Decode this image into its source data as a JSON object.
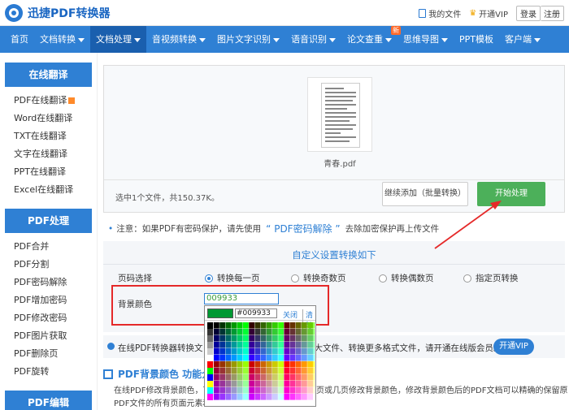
{
  "header": {
    "app_name": "迅捷PDF转换器",
    "my_files": "我的文件",
    "vip": "开通VIP",
    "login": "登录",
    "register": "注册"
  },
  "nav": {
    "items": [
      {
        "label": "首页",
        "dropdown": false
      },
      {
        "label": "文档转换",
        "dropdown": true
      },
      {
        "label": "文档处理",
        "dropdown": true,
        "active": true
      },
      {
        "label": "音视频转换",
        "dropdown": true
      },
      {
        "label": "图片文字识别",
        "dropdown": true
      },
      {
        "label": "语音识别",
        "dropdown": true
      },
      {
        "label": "论文查重",
        "dropdown": true,
        "badge": "新"
      },
      {
        "label": "思维导图",
        "dropdown": true
      },
      {
        "label": "PPT模板",
        "dropdown": false
      },
      {
        "label": "客户端",
        "dropdown": true
      }
    ]
  },
  "sidebar": {
    "sections": [
      {
        "title": "在线翻译",
        "items": [
          "PDF在线翻译",
          "Word在线翻译",
          "TXT在线翻译",
          "文字在线翻译",
          "PPT在线翻译",
          "Excel在线翻译"
        ]
      },
      {
        "title": "PDF处理",
        "items": [
          "PDF合并",
          "PDF分割",
          "PDF密码解除",
          "PDF增加密码",
          "PDF修改密码",
          "PDF图片获取",
          "PDF删除页",
          "PDF旋转"
        ]
      },
      {
        "title": "PDF编辑",
        "items": []
      }
    ]
  },
  "upload": {
    "file_name": "青春.pdf",
    "info": "选中1个文件，共150.37K。",
    "continue_label": "继续添加（批量转换）",
    "start_label": "开始处理"
  },
  "notice": {
    "prefix": "注意：如果PDF有密码保护，请先使用",
    "link": "“ PDF密码解除 ”",
    "suffix": "去除加密保护再上传文件"
  },
  "settings": {
    "title": "自定义设置转换如下",
    "page_select_label": "页码选择",
    "options": [
      "转换每一页",
      "转换奇数页",
      "转换偶数页",
      "指定页转换"
    ],
    "selected_option": "转换每一页",
    "bg_color_label": "背景颜色",
    "bg_color_value": "009933"
  },
  "picker": {
    "current_color": "#009933",
    "hex_value": "#009933",
    "close_label": "关闭",
    "clear_label": "清除"
  },
  "vip_bar": {
    "text_left": "在线PDF转换器转换文",
    "text_right": "更大文件、转换更多格式文件，请开通在线版会员。",
    "button": "开通VIP"
  },
  "section": {
    "title": "PDF背景颜色 功能介绍",
    "paragraph": "在线PDF修改背景颜色，可以直接指定PDF文件中的某一页或几页修改背景颜色，修改背景颜色后的PDF文档可以精确的保留原PDF文件的所有页面元素和排版。"
  },
  "colors": {
    "brand_blue": "#2f80d4",
    "nav_active": "#1a5fae",
    "start_green": "#4cb05a",
    "highlight_red": "#e52929"
  }
}
